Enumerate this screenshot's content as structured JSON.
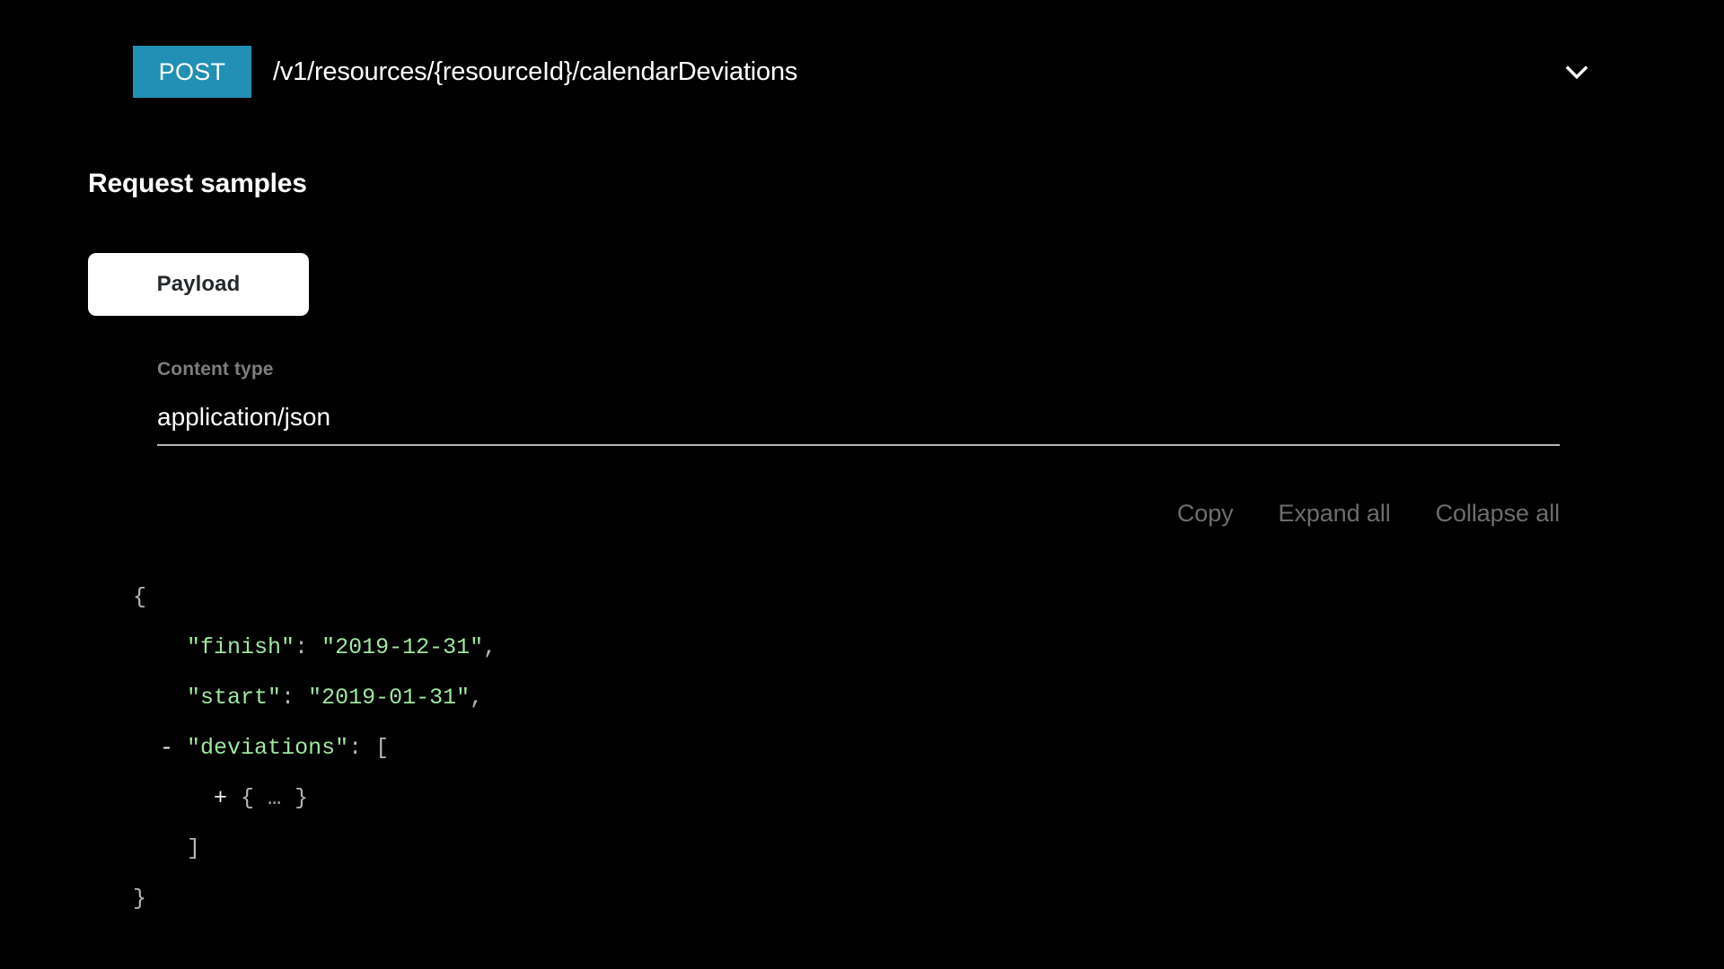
{
  "operation": {
    "method": "POST",
    "path": "/v1/resources/{resourceId}/calendarDeviations",
    "toggle_icon": "chevron-down-icon",
    "method_color": "#2190b4"
  },
  "request_samples": {
    "title": "Request samples",
    "tabs": [
      {
        "label": "Payload",
        "selected": true
      }
    ],
    "content_type": {
      "label": "Content type",
      "value": "application/json",
      "options": [
        "application/json"
      ]
    },
    "toolbar": {
      "copy_label": "Copy",
      "expand_all_label": "Expand all",
      "collapse_all_label": "Collapse all"
    },
    "code": {
      "language": "json",
      "colors": {
        "key": "#9fe89f",
        "string": "#9fe89f",
        "punctuation": "#b6b6b6",
        "toggle": "#f2f2f2",
        "background": "#000000"
      },
      "lines": [
        {
          "indent": 0,
          "toggle": "",
          "tokens": [
            {
              "t": "punct",
              "v": "{"
            }
          ]
        },
        {
          "indent": 1,
          "toggle": "",
          "tokens": [
            {
              "t": "key",
              "v": "\"finish\""
            },
            {
              "t": "punct",
              "v": ": "
            },
            {
              "t": "string",
              "v": "\"2019-12-31\""
            },
            {
              "t": "punct",
              "v": ","
            }
          ]
        },
        {
          "indent": 1,
          "toggle": "",
          "tokens": [
            {
              "t": "key",
              "v": "\"start\""
            },
            {
              "t": "punct",
              "v": ": "
            },
            {
              "t": "string",
              "v": "\"2019-01-31\""
            },
            {
              "t": "punct",
              "v": ","
            }
          ]
        },
        {
          "indent": 1,
          "toggle": "-",
          "tokens": [
            {
              "t": "key",
              "v": "\"deviations\""
            },
            {
              "t": "punct",
              "v": ": "
            },
            {
              "t": "punct",
              "v": "["
            }
          ]
        },
        {
          "indent": 2,
          "toggle": "+",
          "tokens": [
            {
              "t": "punct",
              "v": "{ "
            },
            {
              "t": "ellipsis",
              "v": "…"
            },
            {
              "t": "punct",
              "v": " }"
            }
          ]
        },
        {
          "indent": 1,
          "toggle": "",
          "tokens": [
            {
              "t": "punct",
              "v": "]"
            }
          ]
        },
        {
          "indent": 0,
          "toggle": "",
          "tokens": [
            {
              "t": "punct",
              "v": "}"
            }
          ]
        }
      ]
    }
  }
}
